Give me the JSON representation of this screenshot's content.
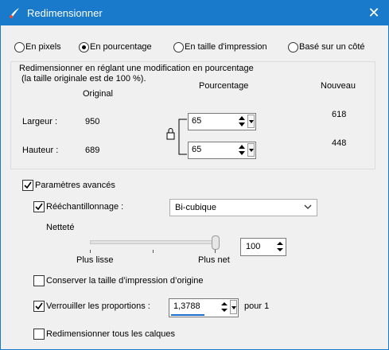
{
  "window": {
    "title": "Redimensionner",
    "close_glyph": "✕"
  },
  "mode": {
    "options": [
      "En pixels",
      "En pourcentage",
      "En taille d'impression",
      "Basé sur un côté"
    ],
    "selected_index": 1
  },
  "group": {
    "description_line1": "Redimensionner en réglant une modification en pourcentage",
    "description_line2": "(la taille originale est de 100 %).",
    "col_original": "Original",
    "col_percent": "Pourcentage",
    "col_new": "Nouveau",
    "width_label": "Largeur :",
    "width_original": "950",
    "width_percent": "65",
    "width_new": "618",
    "height_label": "Hauteur :",
    "height_original": "689",
    "height_percent": "65",
    "height_new": "448"
  },
  "advanced": {
    "label": "Paramètres avancés",
    "checked": true,
    "resample_label": "Rééchantillonnage :",
    "resample_checked": true,
    "resample_value": "Bi-cubique",
    "sharpness_label": "Netteté",
    "slider_min_label": "Plus lisse",
    "slider_max_label": "Plus net",
    "sharpness_value": "100",
    "keep_print_label": "Conserver la taille d’impression d’origine",
    "keep_print_checked": false,
    "lock_ratio_label": "Verrouiller les proportions :",
    "lock_ratio_checked": true,
    "ratio_value": "1,3788",
    "ratio_suffix": "pour 1",
    "all_layers_label": "Redimensionner tous les calques",
    "all_layers_checked": false
  },
  "colors": {
    "titlebar": "#1979ca",
    "focus_underline": "#1f6fd1"
  },
  "icons": {
    "app": "paint-brush-icon",
    "lock": "lock-icon",
    "close": "close-icon"
  }
}
